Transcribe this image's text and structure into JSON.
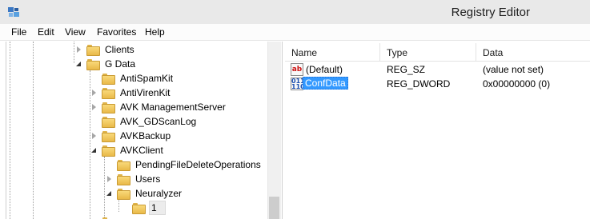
{
  "window": {
    "title": "Registry Editor",
    "icon": "regedit-icon"
  },
  "menu": [
    "File",
    "Edit",
    "View",
    "Favorites",
    "Help"
  ],
  "tree": [
    {
      "label": "Clients",
      "expander": "closed"
    },
    {
      "label": "G Data",
      "expander": "open"
    },
    {
      "label": "AntiSpamKit",
      "expander": "none"
    },
    {
      "label": "AntiVirenKit",
      "expander": "closed"
    },
    {
      "label": "AVK ManagementServer",
      "expander": "closed"
    },
    {
      "label": "AVK_GDScanLog",
      "expander": "none"
    },
    {
      "label": "AVKBackup",
      "expander": "closed"
    },
    {
      "label": "AVKClient",
      "expander": "open"
    },
    {
      "label": "PendingFileDeleteOperations",
      "expander": "none"
    },
    {
      "label": "Users",
      "expander": "closed"
    },
    {
      "label": "Neuralyzer",
      "expander": "open"
    },
    {
      "label": "1",
      "expander": "none",
      "selected": true
    }
  ],
  "list": {
    "columns": [
      "Name",
      "Type",
      "Data"
    ],
    "rows": [
      {
        "icon": "string-value-icon",
        "name": "(Default)",
        "type": "REG_SZ",
        "data": "(value not set)"
      },
      {
        "icon": "dword-value-icon",
        "name": "ConfData",
        "type": "REG_DWORD",
        "data": "0x00000000 (0)",
        "selected": true
      }
    ]
  },
  "colors": {
    "selection": "#3399ff",
    "folder": "#f0c85a",
    "titlebar": "#e9e9e9"
  }
}
